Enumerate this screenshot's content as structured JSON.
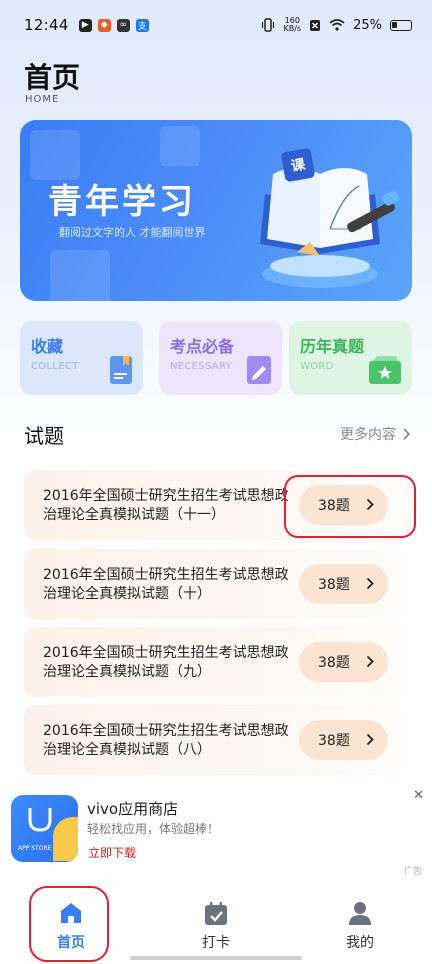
{
  "status_bar": {
    "time": "12:44",
    "net_speed_top": "160",
    "net_speed_bottom": "KB/s",
    "battery": "25%"
  },
  "header": {
    "title": "首页",
    "subtitle": "HOME"
  },
  "banner": {
    "title": "青年学习",
    "subtitle": "翻阅过文字的人 才能翻阅世界",
    "book_badge": "课"
  },
  "categories": [
    {
      "title": "收藏",
      "en": "COLLECT"
    },
    {
      "title": "考点必备",
      "en": "NECESSARY"
    },
    {
      "title": "历年真题",
      "en": "WORD"
    }
  ],
  "section": {
    "title": "试题",
    "more": "更多内容"
  },
  "exams": [
    {
      "title": "2016年全国硕士研究生招生考试思想政治理论全真模拟试题（十一）",
      "count": "38题"
    },
    {
      "title": "2016年全国硕士研究生招生考试思想政治理论全真模拟试题（十）",
      "count": "38题"
    },
    {
      "title": "2016年全国硕士研究生招生考试思想政治理论全真模拟试题（九）",
      "count": "38题"
    },
    {
      "title": "2016年全国硕士研究生招生考试思想政治理论全真模拟试题（八）",
      "count": "38题"
    }
  ],
  "ad": {
    "name": "vivo应用商店",
    "desc": "轻松找应用，体验超棒！",
    "cta": "立即下载",
    "close": "✕",
    "tag": "广告",
    "icon_text": "APP STORE"
  },
  "tabs": [
    {
      "label": "首页",
      "icon": "home-icon",
      "active": true
    },
    {
      "label": "打卡",
      "icon": "calendar-check-icon",
      "active": false
    },
    {
      "label": "我的",
      "icon": "user-icon",
      "active": false
    }
  ],
  "colors": {
    "accent": "#3a7df5",
    "highlight_ring": "#e2222e",
    "count_button": "#fbe4d2"
  }
}
